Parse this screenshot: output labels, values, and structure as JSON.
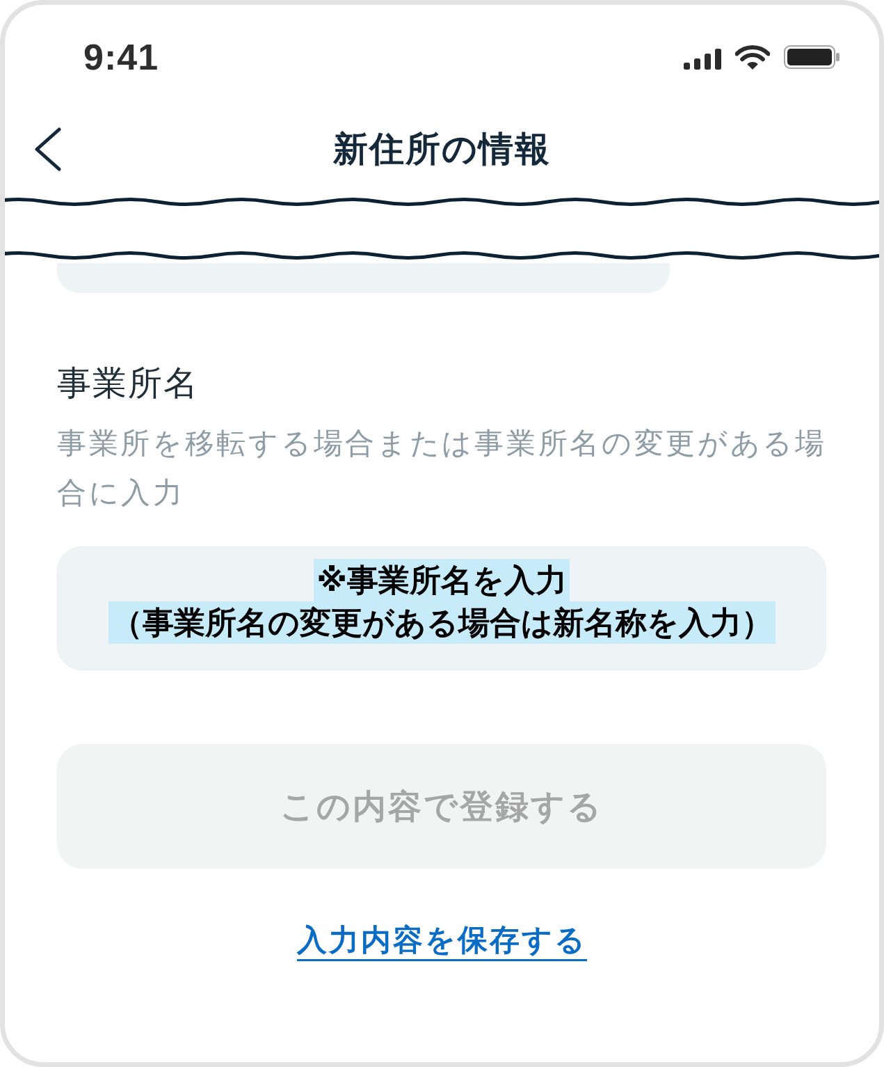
{
  "status_bar": {
    "time": "9:41"
  },
  "header": {
    "title": "新住所の情報"
  },
  "business_name": {
    "label": "事業所名",
    "help": "事業所を移転する場合または事業所名の変更がある場合に入力",
    "annotation": [
      "※事業所名を入力",
      "（事業所名の変更がある場合は新名称を入力）"
    ]
  },
  "submit_button": {
    "label": "この内容で登録する",
    "disabled": true
  },
  "save_link": {
    "label": "入力内容を保存する"
  }
}
